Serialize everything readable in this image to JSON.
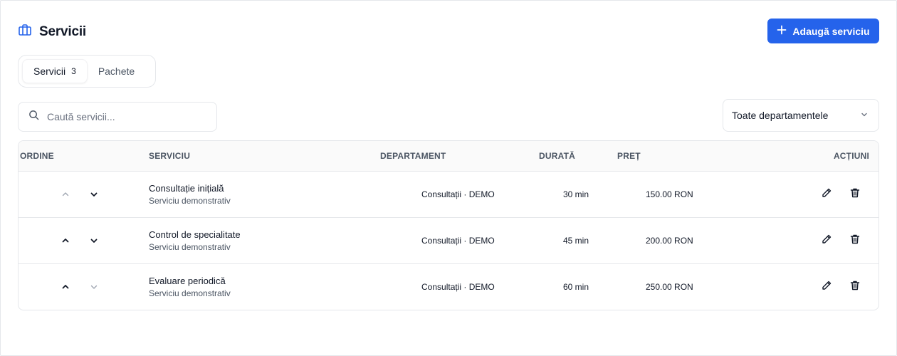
{
  "header": {
    "title": "Servicii",
    "add_button": "Adaugă serviciu",
    "icon": "briefcase-icon"
  },
  "tabs": [
    {
      "label": "Servicii",
      "count": "3",
      "active": true
    },
    {
      "label": "Pachete",
      "active": false
    }
  ],
  "search": {
    "placeholder": "Caută servicii...",
    "value": ""
  },
  "department_filter": {
    "selected": "Toate departamentele"
  },
  "table": {
    "columns": [
      "ORDINE",
      "SERVICIU",
      "DEPARTAMENT",
      "DURATĂ",
      "PREȚ",
      "ACȚIUNI"
    ],
    "rows": [
      {
        "name": "Consultație inițială",
        "description": "Serviciu demonstrativ",
        "department": "Consultații · DEMO",
        "duration": "30 min",
        "price": "150.00 RON",
        "up_enabled": false,
        "down_enabled": true
      },
      {
        "name": "Control de specialitate",
        "description": "Serviciu demonstrativ",
        "department": "Consultații · DEMO",
        "duration": "45 min",
        "price": "200.00 RON",
        "up_enabled": true,
        "down_enabled": true
      },
      {
        "name": "Evaluare periodică",
        "description": "Serviciu demonstrativ",
        "department": "Consultații · DEMO",
        "duration": "60 min",
        "price": "250.00 RON",
        "up_enabled": true,
        "down_enabled": false
      }
    ]
  },
  "colors": {
    "accent": "#2563eb",
    "border": "#e5e7eb",
    "muted": "#4b5563",
    "disabled": "#9ca3af"
  }
}
